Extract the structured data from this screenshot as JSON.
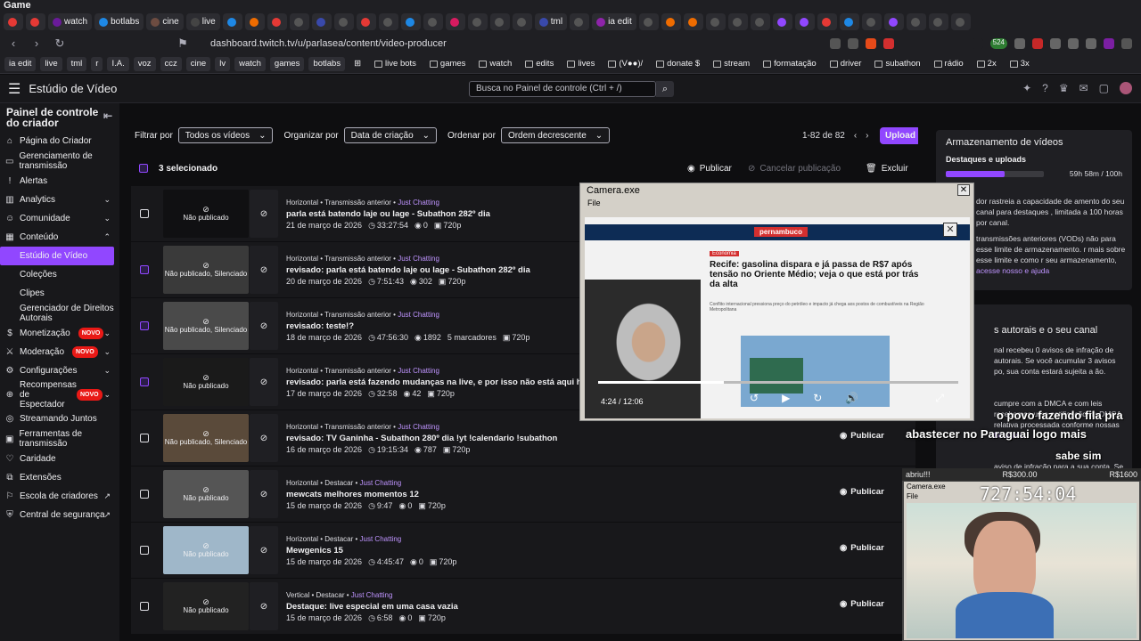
{
  "window_title": "Game",
  "tabs": [
    "",
    "",
    "watch",
    "botlabs",
    "cine",
    "live",
    "",
    "",
    "",
    "",
    "",
    "",
    "",
    "",
    "",
    "",
    "",
    "",
    "",
    "",
    "tml",
    "",
    "ia edit",
    "",
    "",
    "",
    "",
    "",
    "",
    "",
    "",
    "",
    "",
    "",
    "",
    "",
    "",
    ""
  ],
  "url": "dashboard.twitch.tv/u/parlasea/content/video-producer",
  "bookmarks": [
    "ia edit",
    "live",
    "tml",
    "r",
    "I.A.",
    "voz",
    "ccz",
    "cine",
    "lv",
    "watch",
    "games",
    "botlabs"
  ],
  "bookmarks2": [
    "live bots",
    "games",
    "watch",
    "edits",
    "lives",
    "(V●●)/",
    "donate $",
    "stream",
    "formatação",
    "driver",
    "subathon",
    "rádio",
    "2x",
    "3x"
  ],
  "ext_badge": "524",
  "header": {
    "title": "Estúdio de Vídeo",
    "search_placeholder": "Busca no Painel de controle (Ctrl + /)"
  },
  "sidebar": {
    "heading": "Painel de controle do criador",
    "items": [
      {
        "label": "Página do Criador"
      },
      {
        "label": "Gerenciamento de transmissão"
      },
      {
        "label": "Alertas"
      },
      {
        "label": "Analytics"
      },
      {
        "label": "Comunidade"
      },
      {
        "label": "Conteúdo"
      },
      {
        "label": "Estúdio de Vídeo"
      },
      {
        "label": "Coleções"
      },
      {
        "label": "Clipes"
      },
      {
        "label": "Gerenciador de Direitos Autorais"
      },
      {
        "label": "Monetização",
        "badge": "NOVO"
      },
      {
        "label": "Moderação",
        "badge": "NOVO"
      },
      {
        "label": "Configurações"
      },
      {
        "label": "Recompensas de Espectador",
        "badge": "NOVO"
      },
      {
        "label": "Streamando Juntos"
      },
      {
        "label": "Ferramentas de transmissão"
      },
      {
        "label": "Caridade"
      },
      {
        "label": "Extensões"
      },
      {
        "label": "Escola de criadores"
      },
      {
        "label": "Central de segurança"
      }
    ]
  },
  "filters": {
    "filter_label": "Filtrar por",
    "filter_value": "Todos os vídeos",
    "sort_label": "Organizar por",
    "sort_value": "Data de criação",
    "order_label": "Ordenar por",
    "order_value": "Ordem decrescente",
    "pager": "1-82 de 82",
    "upload": "Upload"
  },
  "selection": {
    "count": "3 selecionado",
    "publish": "Publicar",
    "cancel": "Cancelar publicação",
    "delete": "Excluir"
  },
  "videos": [
    {
      "checked": false,
      "cat": "Horizontal • Transmissão anterior • ",
      "game": "Just Chatting",
      "title": "parla está batendo laje ou lage - Subathon 282º dia",
      "date": "21 de março de 2026",
      "dur": "33:27:54",
      "views": "0",
      "extra": "",
      "q": "720p",
      "status": "Não publicado",
      "pub": ""
    },
    {
      "checked": true,
      "cat": "Horizontal • Transmissão anterior • ",
      "game": "Just Chatting",
      "title": "revisado: parla está batendo laje ou lage - Subathon 282º dia",
      "date": "20 de março de 2026",
      "dur": "7:51:43",
      "views": "302",
      "extra": "",
      "q": "720p",
      "status": "Não publicado, Silenciado",
      "pub": ""
    },
    {
      "checked": true,
      "cat": "Horizontal • Transmissão anterior • ",
      "game": "Just Chatting",
      "title": "revisado: teste!?",
      "date": "18 de março de 2026",
      "dur": "47:56:30",
      "views": "1892",
      "extra": "5 marcadores",
      "q": "720p",
      "status": "Não publicado, Silenciado",
      "pub": ""
    },
    {
      "checked": true,
      "cat": "Horizontal • Transmissão anterior • ",
      "game": "Just Chatting",
      "title": "revisado: parla está fazendo mudanças na live, e por isso não está aqui hoje - Sub",
      "date": "17 de março de 2026",
      "dur": "32:58",
      "views": "42",
      "extra": "",
      "q": "720p",
      "status": "Não publicado",
      "pub": ""
    },
    {
      "checked": false,
      "cat": "Horizontal • Transmissão anterior • ",
      "game": "Just Chatting",
      "title": "revisado: TV Ganinha - Subathon 280º dia !yt !calendario !subathon",
      "date": "16 de março de 2026",
      "dur": "19:15:34",
      "views": "787",
      "extra": "",
      "q": "720p",
      "status": "Não publicado, Silenciado",
      "pub": "Publicar"
    },
    {
      "checked": false,
      "cat": "Horizontal • Destacar • ",
      "game": "Just Chatting",
      "title": "mewcats melhores momentos 12",
      "date": "15 de março de 2026",
      "dur": "9:47",
      "views": "0",
      "extra": "",
      "q": "720p",
      "status": "Não publicado",
      "pub": "Publicar"
    },
    {
      "checked": false,
      "cat": "Horizontal • Destacar • ",
      "game": "Just Chatting",
      "title": "Mewgenics 15",
      "date": "15 de março de 2026",
      "dur": "4:45:47",
      "views": "0",
      "extra": "",
      "q": "720p",
      "status": "Não publicado",
      "pub": "Publicar"
    },
    {
      "checked": false,
      "cat": "Vertical • Destacar • ",
      "game": "Just Chatting",
      "title": "Destaque: live especial em uma casa vazia",
      "date": "15 de março de 2026",
      "dur": "6:58",
      "views": "0",
      "extra": "",
      "q": "720p",
      "status": "Não publicado",
      "pub": "Publicar"
    }
  ],
  "storage": {
    "title": "Armazenamento de vídeos",
    "label": "Destaques e uploads",
    "used_fraction": 0.6,
    "time": "59h 58m / 100h",
    "text1": "dor rastreia a capacidade de amento do seu canal para destaques , limitada a 100 horas por canal.",
    "text2": "transmissões anteriores (VODs) não para esse limite de armazenamento. r mais sobre esse limite e como r seu armazenamento, ",
    "link1": "acesse nosso",
    "link2": "e ajuda",
    "heading2": "s autorais e o seu canal",
    "text3": "nal recebeu 0 avisos de infração de autorais. Se você acumular 3 avisos po, sua conta estará sujeita a ão.",
    "text4": "cumpre com a DMCA e com leis recebemos uma notificação de DMCA relativa processada conforme nossas ",
    "link3": "Diretrizes",
    "text5": "aviso de infração para a sua conta. Se isso"
  },
  "popup": {
    "title": "Camera.exe",
    "menu": "File",
    "eco": "Economia",
    "site": "pernambuco",
    "headline": "Recife: gasolina dispara e já passa de R$7 após tensão no Oriente Médio; veja o que está por trás da alta",
    "sub": "Conflito internacional pressiona preço do petróleo e impacto já chega aos postos de combustíveis na Região Metropolitana",
    "time": "4:24 / 12:06",
    "progress_fraction": 0.35
  },
  "overlay": {
    "line1": "o povo fazendo fila pra",
    "line2": "abastecer no Paraguai logo mais",
    "line3": "sabe sim"
  },
  "cam2": {
    "stripe_left": "abriu!!!",
    "stripe_mid": "R$300.00",
    "stripe_right": "R$1600",
    "title": "Camera.exe",
    "menu": "File",
    "clock": "727:54:04"
  }
}
